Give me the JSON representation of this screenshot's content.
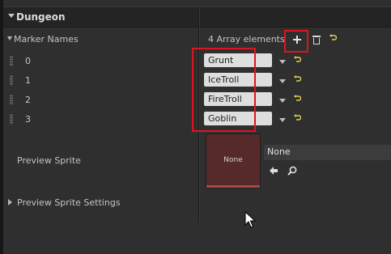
{
  "category": {
    "title": "Dungeon"
  },
  "marker_names": {
    "label": "Marker Names",
    "count_text": "4 Array elements",
    "elements": [
      {
        "index": "0",
        "value": "Grunt"
      },
      {
        "index": "1",
        "value": "IceTroll"
      },
      {
        "index": "2",
        "value": "FireTroll"
      },
      {
        "index": "3",
        "value": "Goblin"
      }
    ]
  },
  "preview_sprite": {
    "label": "Preview Sprite",
    "thumbnail_text": "None",
    "asset_value": "None"
  },
  "preview_sprite_settings": {
    "label": "Preview Sprite Settings"
  },
  "icons": {
    "add": "plus-icon",
    "delete": "trash-icon",
    "reset": "reset-to-default-icon",
    "use_selected": "arrow-left-icon",
    "browse": "search-icon"
  },
  "colors": {
    "highlight": "#e0141e",
    "reset_icon": "#e6d24a",
    "thumbnail": "#562a2a"
  }
}
